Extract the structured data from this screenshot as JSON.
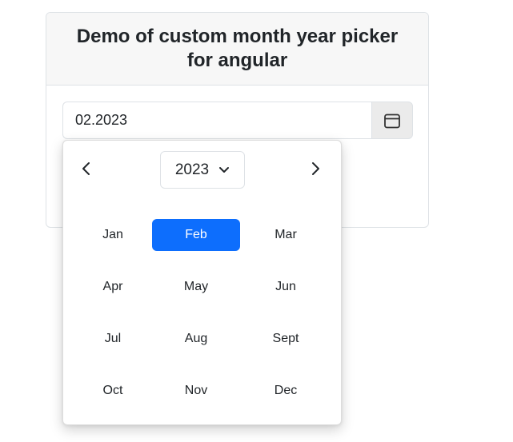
{
  "header": {
    "title": "Demo of custom month year picker for angular"
  },
  "date_input": {
    "value": "02.2023"
  },
  "picker": {
    "year": "2023",
    "selected_month": "Feb",
    "months": [
      "Jan",
      "Feb",
      "Mar",
      "Apr",
      "May",
      "Jun",
      "Jul",
      "Aug",
      "Sept",
      "Oct",
      "Nov",
      "Dec"
    ],
    "icons": {
      "calendar": "calendar-icon",
      "prev": "chevron-left-icon",
      "next": "chevron-right-icon",
      "dropdown": "chevron-down-icon"
    }
  },
  "colors": {
    "accent": "#0d6efd",
    "header_bg": "#f7f7f7",
    "button_bg": "#ebebeb"
  }
}
